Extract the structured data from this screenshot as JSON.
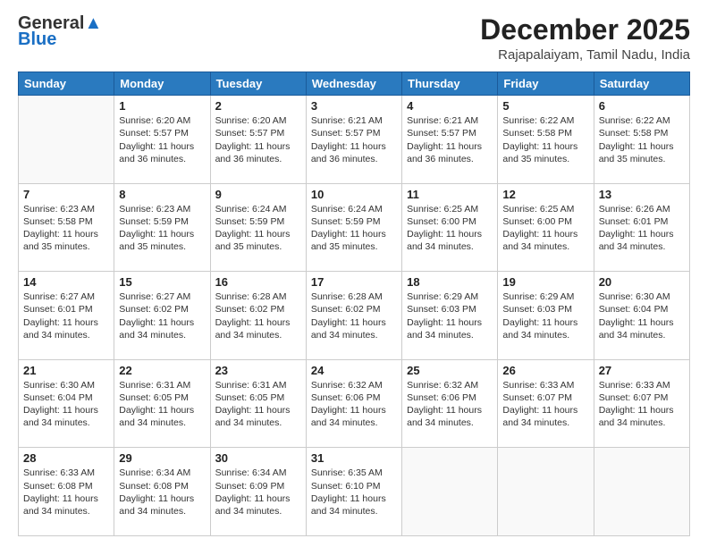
{
  "logo": {
    "general": "General",
    "blue": "Blue"
  },
  "title": "December 2025",
  "subtitle": "Rajapalaiyam, Tamil Nadu, India",
  "days": [
    "Sunday",
    "Monday",
    "Tuesday",
    "Wednesday",
    "Thursday",
    "Friday",
    "Saturday"
  ],
  "weeks": [
    [
      {
        "day": "",
        "info": ""
      },
      {
        "day": "1",
        "info": "Sunrise: 6:20 AM\nSunset: 5:57 PM\nDaylight: 11 hours and 36 minutes."
      },
      {
        "day": "2",
        "info": "Sunrise: 6:20 AM\nSunset: 5:57 PM\nDaylight: 11 hours and 36 minutes."
      },
      {
        "day": "3",
        "info": "Sunrise: 6:21 AM\nSunset: 5:57 PM\nDaylight: 11 hours and 36 minutes."
      },
      {
        "day": "4",
        "info": "Sunrise: 6:21 AM\nSunset: 5:57 PM\nDaylight: 11 hours and 36 minutes."
      },
      {
        "day": "5",
        "info": "Sunrise: 6:22 AM\nSunset: 5:58 PM\nDaylight: 11 hours and 35 minutes."
      },
      {
        "day": "6",
        "info": "Sunrise: 6:22 AM\nSunset: 5:58 PM\nDaylight: 11 hours and 35 minutes."
      }
    ],
    [
      {
        "day": "7",
        "info": "Sunrise: 6:23 AM\nSunset: 5:58 PM\nDaylight: 11 hours and 35 minutes."
      },
      {
        "day": "8",
        "info": "Sunrise: 6:23 AM\nSunset: 5:59 PM\nDaylight: 11 hours and 35 minutes."
      },
      {
        "day": "9",
        "info": "Sunrise: 6:24 AM\nSunset: 5:59 PM\nDaylight: 11 hours and 35 minutes."
      },
      {
        "day": "10",
        "info": "Sunrise: 6:24 AM\nSunset: 5:59 PM\nDaylight: 11 hours and 35 minutes."
      },
      {
        "day": "11",
        "info": "Sunrise: 6:25 AM\nSunset: 6:00 PM\nDaylight: 11 hours and 34 minutes."
      },
      {
        "day": "12",
        "info": "Sunrise: 6:25 AM\nSunset: 6:00 PM\nDaylight: 11 hours and 34 minutes."
      },
      {
        "day": "13",
        "info": "Sunrise: 6:26 AM\nSunset: 6:01 PM\nDaylight: 11 hours and 34 minutes."
      }
    ],
    [
      {
        "day": "14",
        "info": "Sunrise: 6:27 AM\nSunset: 6:01 PM\nDaylight: 11 hours and 34 minutes."
      },
      {
        "day": "15",
        "info": "Sunrise: 6:27 AM\nSunset: 6:02 PM\nDaylight: 11 hours and 34 minutes."
      },
      {
        "day": "16",
        "info": "Sunrise: 6:28 AM\nSunset: 6:02 PM\nDaylight: 11 hours and 34 minutes."
      },
      {
        "day": "17",
        "info": "Sunrise: 6:28 AM\nSunset: 6:02 PM\nDaylight: 11 hours and 34 minutes."
      },
      {
        "day": "18",
        "info": "Sunrise: 6:29 AM\nSunset: 6:03 PM\nDaylight: 11 hours and 34 minutes."
      },
      {
        "day": "19",
        "info": "Sunrise: 6:29 AM\nSunset: 6:03 PM\nDaylight: 11 hours and 34 minutes."
      },
      {
        "day": "20",
        "info": "Sunrise: 6:30 AM\nSunset: 6:04 PM\nDaylight: 11 hours and 34 minutes."
      }
    ],
    [
      {
        "day": "21",
        "info": "Sunrise: 6:30 AM\nSunset: 6:04 PM\nDaylight: 11 hours and 34 minutes."
      },
      {
        "day": "22",
        "info": "Sunrise: 6:31 AM\nSunset: 6:05 PM\nDaylight: 11 hours and 34 minutes."
      },
      {
        "day": "23",
        "info": "Sunrise: 6:31 AM\nSunset: 6:05 PM\nDaylight: 11 hours and 34 minutes."
      },
      {
        "day": "24",
        "info": "Sunrise: 6:32 AM\nSunset: 6:06 PM\nDaylight: 11 hours and 34 minutes."
      },
      {
        "day": "25",
        "info": "Sunrise: 6:32 AM\nSunset: 6:06 PM\nDaylight: 11 hours and 34 minutes."
      },
      {
        "day": "26",
        "info": "Sunrise: 6:33 AM\nSunset: 6:07 PM\nDaylight: 11 hours and 34 minutes."
      },
      {
        "day": "27",
        "info": "Sunrise: 6:33 AM\nSunset: 6:07 PM\nDaylight: 11 hours and 34 minutes."
      }
    ],
    [
      {
        "day": "28",
        "info": "Sunrise: 6:33 AM\nSunset: 6:08 PM\nDaylight: 11 hours and 34 minutes."
      },
      {
        "day": "29",
        "info": "Sunrise: 6:34 AM\nSunset: 6:08 PM\nDaylight: 11 hours and 34 minutes."
      },
      {
        "day": "30",
        "info": "Sunrise: 6:34 AM\nSunset: 6:09 PM\nDaylight: 11 hours and 34 minutes."
      },
      {
        "day": "31",
        "info": "Sunrise: 6:35 AM\nSunset: 6:10 PM\nDaylight: 11 hours and 34 minutes."
      },
      {
        "day": "",
        "info": ""
      },
      {
        "day": "",
        "info": ""
      },
      {
        "day": "",
        "info": ""
      }
    ]
  ]
}
